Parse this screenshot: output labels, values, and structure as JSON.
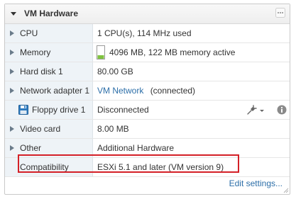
{
  "panel": {
    "title": "VM Hardware",
    "edit_label": "Edit settings..."
  },
  "rows": [
    {
      "label": "CPU",
      "value": "1 CPU(s), 114 MHz used",
      "expandable": true
    },
    {
      "label": "Memory",
      "value": "4096 MB, 122 MB memory active",
      "expandable": true,
      "icon": "memory-meter-icon"
    },
    {
      "label": "Hard disk 1",
      "value": "80.00 GB",
      "expandable": true
    },
    {
      "label": "Network adapter 1",
      "link": "VM Network",
      "suffix": "(connected)",
      "expandable": true
    },
    {
      "label": "Floppy drive 1",
      "value": "Disconnected",
      "expandable": false,
      "icon": "floppy-disk-icon"
    },
    {
      "label": "Video card",
      "value": "8.00 MB",
      "expandable": true
    },
    {
      "label": "Other",
      "value": "Additional Hardware",
      "expandable": true
    },
    {
      "label": "Compatibility",
      "value": "ESXi 5.1 and later (VM version 9)",
      "expandable": false
    }
  ],
  "icons": {
    "header_toggle": "collapse-triangle-icon",
    "header_menu": "more-options-icon",
    "floppy_actions": "connect-plug-icon",
    "floppy_info": "info-icon"
  },
  "colors": {
    "link": "#2c6ea8",
    "highlight": "#d42027",
    "label_bg": "#eef3f7",
    "memory_fill": "#7fc33f"
  }
}
